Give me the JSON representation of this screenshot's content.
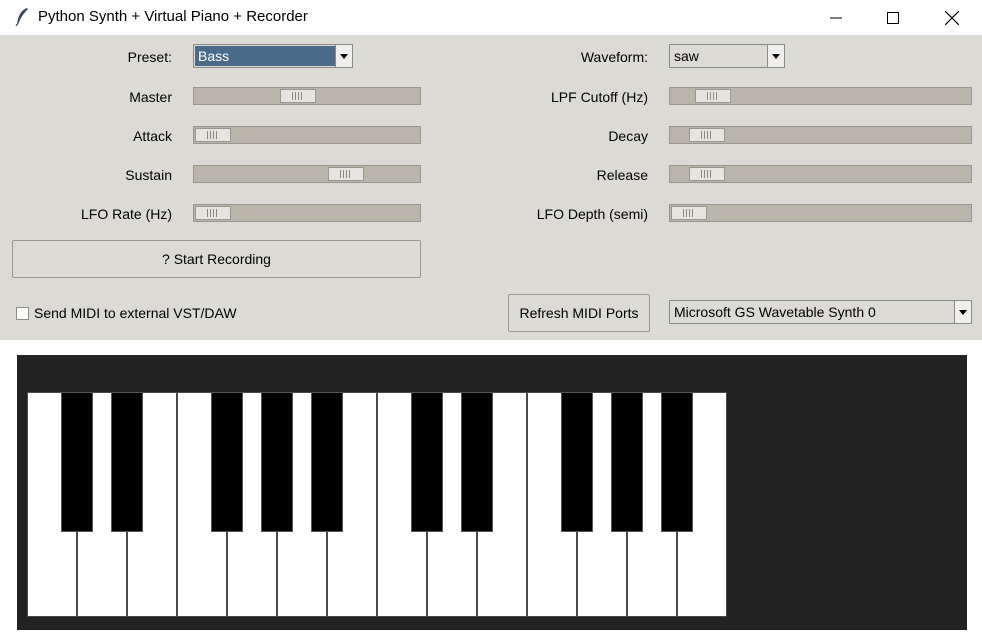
{
  "window": {
    "title": "Python Synth + Virtual Piano + Recorder"
  },
  "controls": {
    "preset": {
      "label": "Preset:",
      "value": "Bass"
    },
    "waveform": {
      "label": "Waveform:",
      "value": "saw"
    },
    "master": {
      "label": "Master",
      "level": 0.45
    },
    "lpf_cutoff": {
      "label": "LPF Cutoff (Hz)",
      "level": 0.09
    },
    "attack": {
      "label": "Attack",
      "level": 0.0
    },
    "decay": {
      "label": "Decay",
      "level": 0.07
    },
    "sustain": {
      "label": "Sustain",
      "level": 0.71
    },
    "release": {
      "label": "Release",
      "level": 0.07
    },
    "lfo_rate": {
      "label": "LFO Rate (Hz)",
      "level": 0.0
    },
    "lfo_depth": {
      "label": "LFO Depth (semi)",
      "level": 0.0
    },
    "record_button": {
      "label": "? Start Recording"
    },
    "send_midi": {
      "label": "Send MIDI to external VST/DAW",
      "checked": false
    },
    "refresh_button": {
      "label": "Refresh MIDI Ports"
    },
    "midi_port": {
      "value": "Microsoft GS Wavetable Synth 0"
    }
  },
  "piano": {
    "white_keys": 14,
    "black_keys": 10
  },
  "colors": {
    "preset_selection": "#4a6a8a",
    "piano_background": "#222222"
  }
}
